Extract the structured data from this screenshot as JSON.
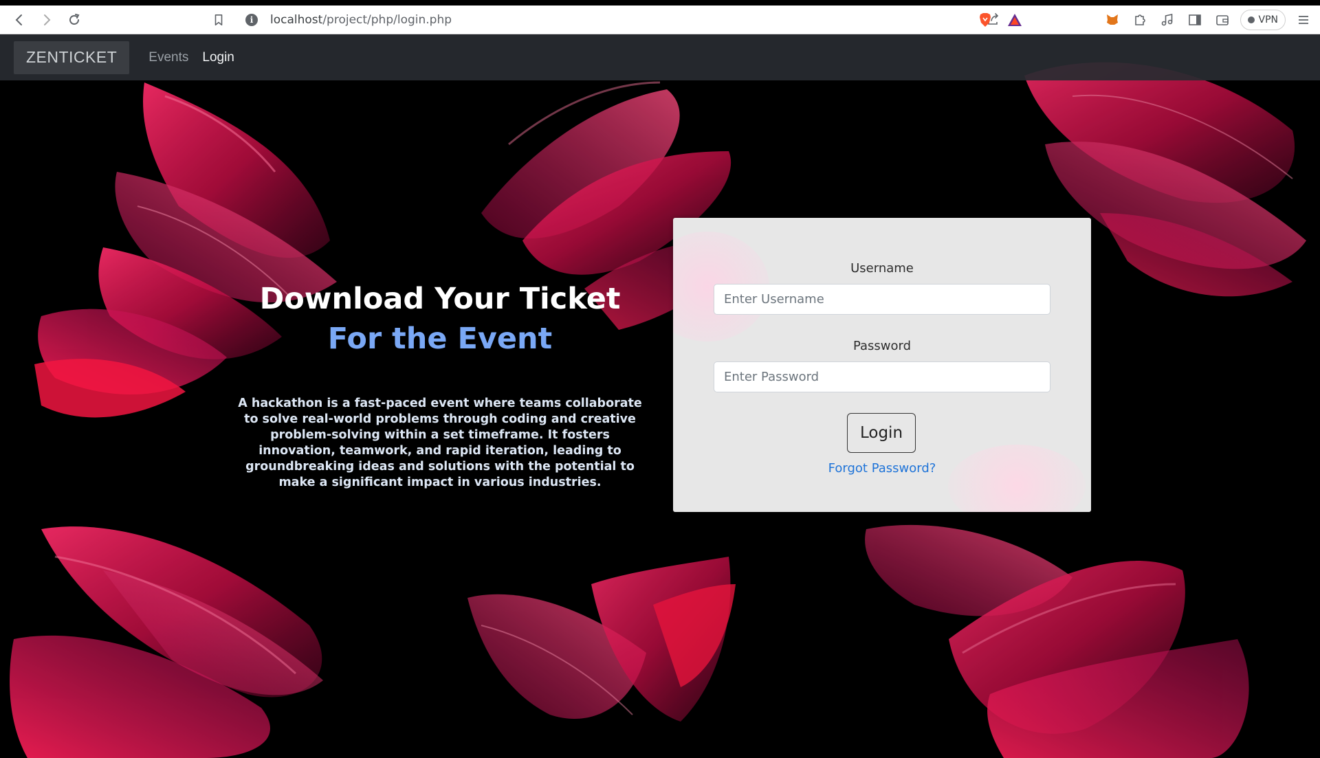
{
  "browser": {
    "url_host": "localhost",
    "url_path": "/project/php/login.php",
    "vpn_label": "VPN"
  },
  "navbar": {
    "brand": "ZENTICKET",
    "links": [
      "Events",
      "Login"
    ]
  },
  "hero": {
    "title_line1": "Download Your Ticket",
    "title_line2": "For the Event",
    "description": "A hackathon is a fast-paced event where teams collaborate to solve real-world problems through coding and creative problem-solving within a set timeframe. It fosters innovation, teamwork, and rapid iteration, leading to groundbreaking ideas and solutions with the potential to make a significant impact in various industries."
  },
  "login_form": {
    "username_label": "Username",
    "username_placeholder": "Enter Username",
    "password_label": "Password",
    "password_placeholder": "Enter Password",
    "submit_label": "Login",
    "forgot_label": "Forgot Password?"
  },
  "colors": {
    "accent_blue": "#7aa8f5",
    "link_blue": "#1e73d8",
    "ribbon_pink": "#ff1a5e",
    "navbar": "#282b30"
  }
}
